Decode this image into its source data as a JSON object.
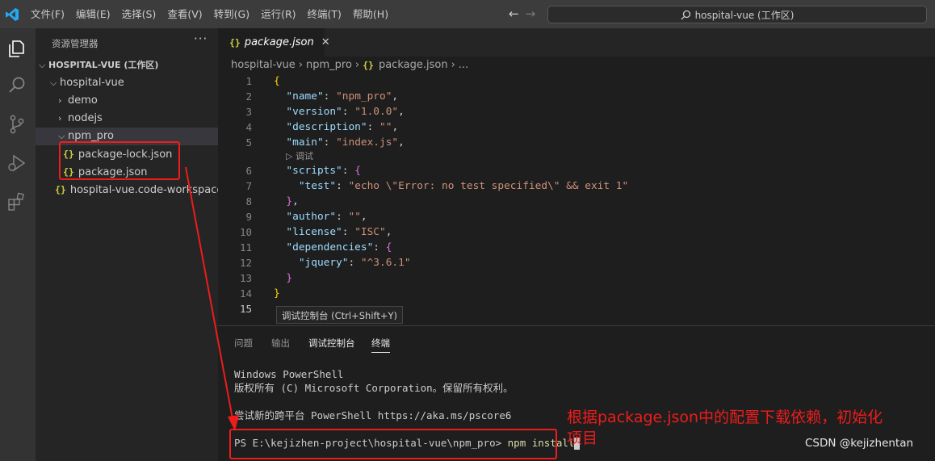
{
  "menu": [
    "文件(F)",
    "编辑(E)",
    "选择(S)",
    "查看(V)",
    "转到(G)",
    "运行(R)",
    "终端(T)",
    "帮助(H)"
  ],
  "command_center": "hospital-vue (工作区)",
  "explorer": {
    "title": "资源管理器",
    "workspace": "HOSPITAL-VUE (工作区)",
    "root": "hospital-vue",
    "items": [
      "demo",
      "nodejs",
      "npm_pro",
      "package-lock.json",
      "package.json",
      "hospital-vue.code-workspace"
    ]
  },
  "tab": {
    "name": "package.json"
  },
  "breadcrumb": [
    "hospital-vue",
    "npm_pro",
    "package.json",
    "..."
  ],
  "code": {
    "line_numbers": [
      "1",
      "2",
      "3",
      "4",
      "5",
      "6",
      "7",
      "8",
      "9",
      "10",
      "11",
      "12",
      "13",
      "14",
      "15"
    ],
    "codelens": "▷ 调试"
  },
  "tooltip": "调试控制台 (Ctrl+Shift+Y)",
  "panel_tabs": [
    "问题",
    "输出",
    "调试控制台",
    "终端"
  ],
  "terminal": {
    "line1": "Windows PowerShell",
    "line2": "版权所有 (C) Microsoft Corporation。保留所有权利。",
    "line3": "尝试新的跨平台 PowerShell https://aka.ms/pscore6",
    "prompt": "PS E:\\kejizhen-project\\hospital-vue\\npm_pro> ",
    "command": "npm install"
  },
  "annotation": "根据package.json中的配置下载依赖，初始化项目",
  "watermark": "CSDN @kejizhentan",
  "colors": {
    "accent_red": "#ee1c1c",
    "json_icon": "#cbcb41"
  }
}
